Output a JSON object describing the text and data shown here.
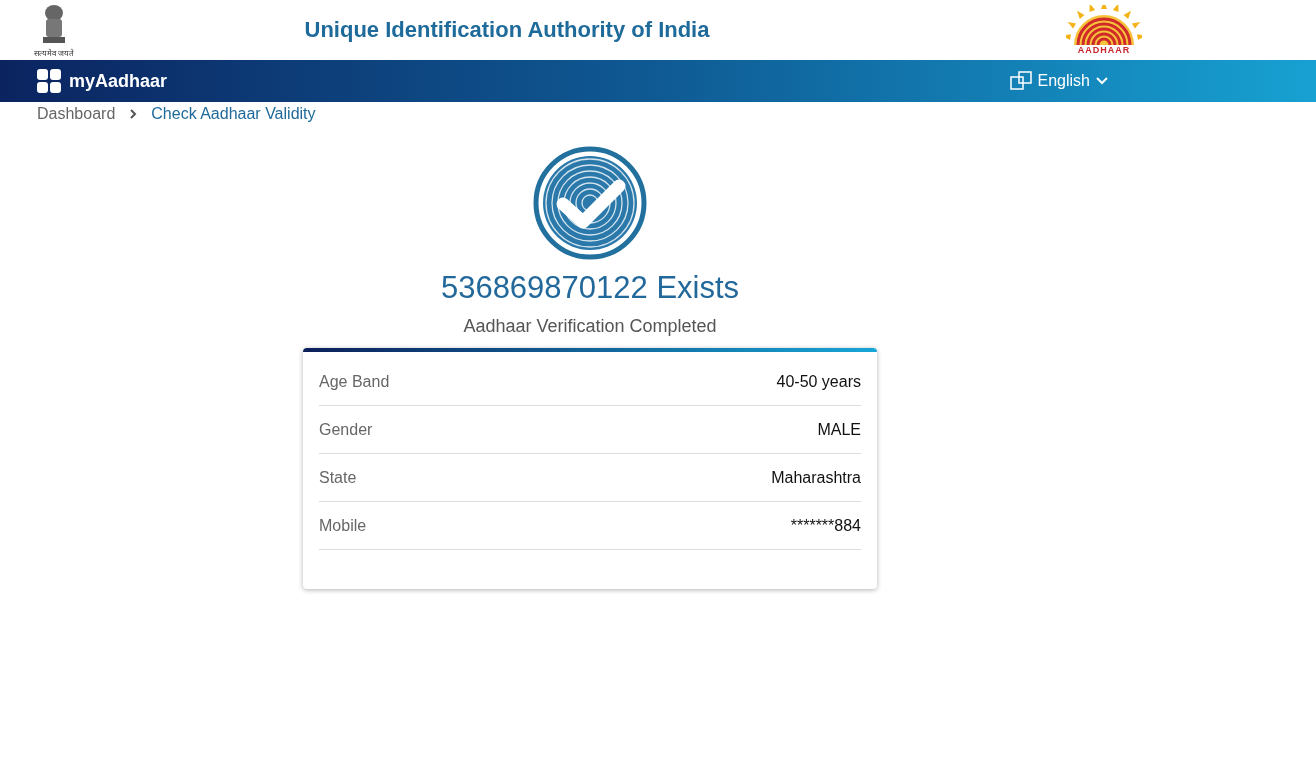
{
  "header": {
    "emblem_motto": "सत्यमेव जयते",
    "title": "Unique Identification Authority of India",
    "logo_text": "AADHAAR"
  },
  "navbar": {
    "brand": "myAadhaar",
    "language": "English"
  },
  "breadcrumb": [
    {
      "label": "Dashboard",
      "selected": false
    },
    {
      "label": "Check Aadhaar Validity",
      "selected": true
    }
  ],
  "result": {
    "heading": "536869870122 Exists",
    "subtitle": "Aadhaar Verification Completed"
  },
  "details": [
    {
      "label": "Age Band",
      "value": "40-50 years"
    },
    {
      "label": "Gender",
      "value": "MALE"
    },
    {
      "label": "State",
      "value": "Maharashtra"
    },
    {
      "label": "Mobile",
      "value": "*******884"
    }
  ]
}
